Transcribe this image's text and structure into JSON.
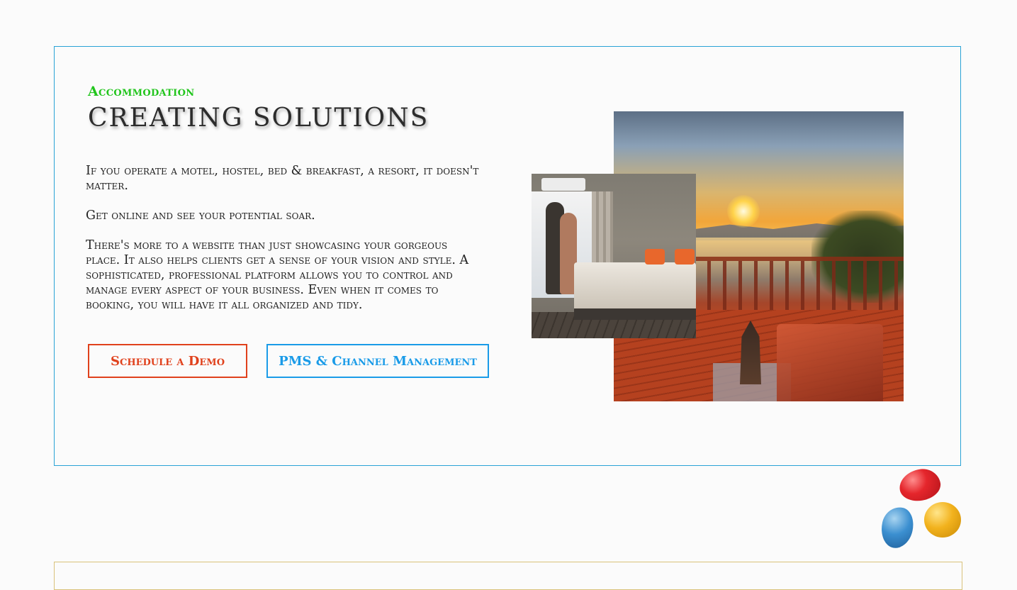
{
  "section": {
    "eyebrow": "Accommodation",
    "title": "CREATING SOLUTIONS",
    "paragraphs": [
      "If you operate a motel, hostel, bed & breakfast, a resort, it doesn't matter.",
      "Get online and see your potential soar.",
      "There's more to a website than just showcasing your gorgeous place. It also helps clients get a sense of your vision and style. A sophisticated, professional platform allows you to control and manage every aspect of your business. Even when it comes to booking, you will have it all organized and tidy."
    ],
    "buttons": {
      "demo_label": "Schedule a Demo",
      "pms_label": "PMS & Channel Management"
    }
  },
  "colors": {
    "eyebrow": "#22c51d",
    "panel_border": "#2aa3d6",
    "demo_button": "#e0411c",
    "pms_button": "#1a9be8",
    "bottom_panel_border": "#d9c27a"
  },
  "images": {
    "main": "sunset-balcony-photo",
    "inset": "hotel-room-photo"
  },
  "logo": "colored-blobs-logo"
}
